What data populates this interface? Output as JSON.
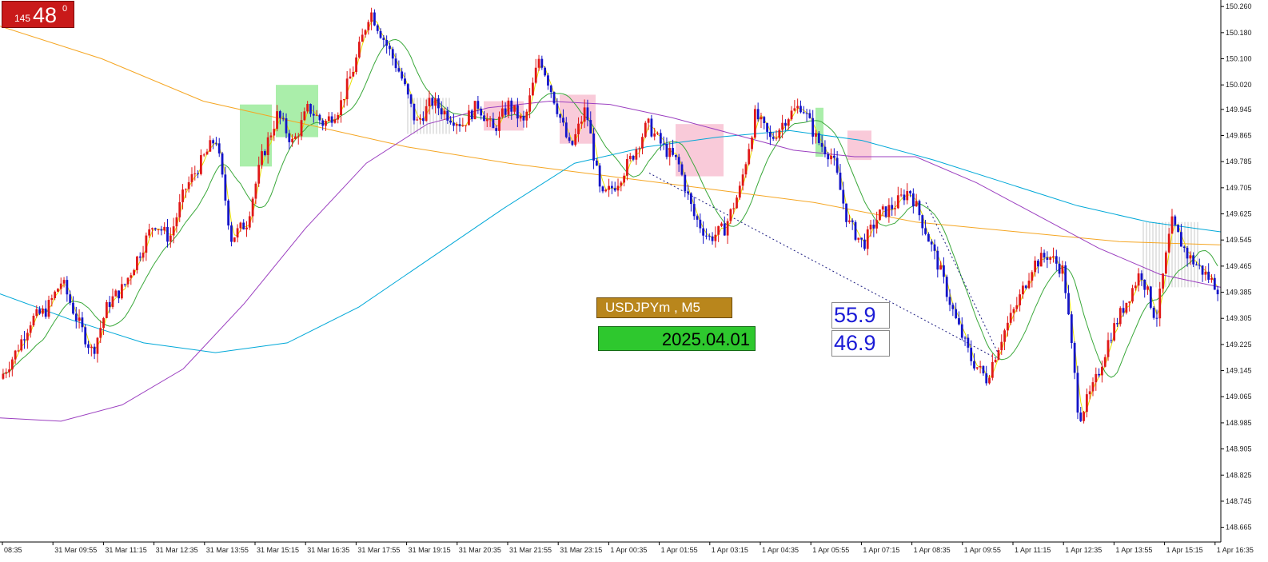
{
  "chart_data": {
    "type": "candlestick",
    "symbol": "USDJPYm",
    "timeframe": "M5",
    "date_label": "2025.04.01",
    "ylim": [
      148.62,
      150.28
    ],
    "y_ticks": [
      "150.260",
      "150.180",
      "150.100",
      "150.020",
      "149.945",
      "149.865",
      "149.785",
      "149.705",
      "149.625",
      "149.545",
      "149.465",
      "149.385",
      "149.305",
      "149.225",
      "149.145",
      "149.065",
      "148.985",
      "148.905",
      "148.825",
      "148.745",
      "148.665"
    ],
    "x_ticks": [
      "08:35",
      "31 Mar 09:55",
      "31 Mar 11:15",
      "31 Mar 12:35",
      "31 Mar 13:55",
      "31 Mar 15:15",
      "31 Mar 16:35",
      "31 Mar 17:55",
      "31 Mar 19:15",
      "31 Mar 20:35",
      "31 Mar 21:55",
      "31 Mar 23:15",
      "1 Apr 00:35",
      "1 Apr 01:55",
      "1 Apr 03:15",
      "1 Apr 04:35",
      "1 Apr 05:55",
      "1 Apr 07:15",
      "1 Apr 08:35",
      "1 Apr 09:55",
      "1 Apr 11:15",
      "1 Apr 12:35",
      "1 Apr 13:55",
      "1 Apr 15:15",
      "1 Apr 16:35"
    ],
    "price_path": [
      149.12,
      149.2,
      149.3,
      149.33,
      149.42,
      149.3,
      149.2,
      149.35,
      149.4,
      149.5,
      149.6,
      149.55,
      149.7,
      149.78,
      149.86,
      149.55,
      149.6,
      149.8,
      149.93,
      149.84,
      149.95,
      149.9,
      149.95,
      150.08,
      150.25,
      150.15,
      150.05,
      149.9,
      149.97,
      149.93,
      149.9,
      149.96,
      149.88,
      149.96,
      149.9,
      150.11,
      149.97,
      149.82,
      149.95,
      149.67,
      149.72,
      149.8,
      149.9,
      149.83,
      149.78,
      149.62,
      149.55,
      149.58,
      149.7,
      149.93,
      149.85,
      149.92,
      149.96,
      149.85,
      149.8,
      149.6,
      149.53,
      149.62,
      149.65,
      149.7,
      149.58,
      149.45,
      149.3,
      149.18,
      149.12,
      149.25,
      149.35,
      149.47,
      149.5,
      149.45,
      149.0,
      149.1,
      149.25,
      149.35,
      149.45,
      149.3,
      149.6,
      149.5,
      149.45,
      149.4
    ],
    "volatility": 0.045,
    "candle_count": 400,
    "moving_averages": [
      {
        "color": "#f5a623",
        "values": [
          150.2,
          150.1,
          149.97,
          149.9,
          149.83,
          149.78,
          149.74,
          149.7,
          149.66,
          149.6,
          149.57,
          149.54,
          149.53
        ]
      },
      {
        "color": "#00a8d8",
        "values": [
          149.38,
          149.3,
          149.23,
          149.2,
          149.23,
          149.34,
          149.49,
          149.64,
          149.78,
          149.83,
          149.86,
          149.88,
          149.85,
          149.79,
          149.72,
          149.65,
          149.6,
          149.57
        ]
      },
      {
        "color": "#9b3fc0",
        "values": [
          149.0,
          148.99,
          149.04,
          149.15,
          149.35,
          149.58,
          149.78,
          149.9,
          149.95,
          149.97,
          149.96,
          149.92,
          149.87,
          149.82,
          149.8,
          149.8,
          149.72,
          149.62,
          149.52,
          149.44,
          149.4
        ]
      }
    ],
    "up_color": "#e01818",
    "down_color": "#1414c8"
  },
  "overlays": {
    "timer": {
      "small": "145",
      "big": "48",
      "sup": "0"
    },
    "symbol_label": "USDJPYm , M5",
    "date_label": "2025.04.01",
    "rsi_high": "55.9",
    "rsi_low": "46.9"
  }
}
